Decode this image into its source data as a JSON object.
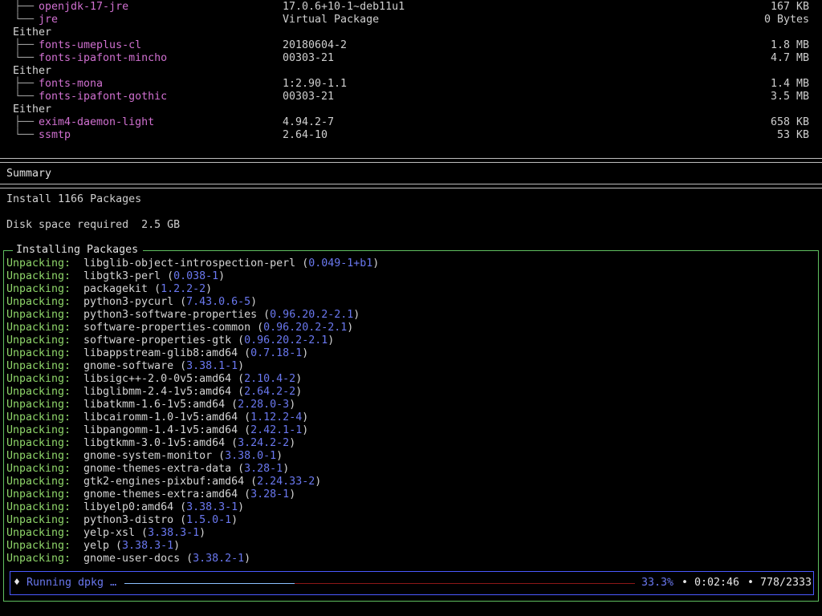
{
  "dependencies": [
    {
      "kind": "pkg",
      "tree": "├──",
      "name": "openjdk-17-jre",
      "version": "17.0.6+10-1~deb11u1",
      "size": "167 KB"
    },
    {
      "kind": "pkg",
      "tree": "└──",
      "name": "jre",
      "version": "Virtual Package",
      "size": "0 Bytes"
    },
    {
      "kind": "either",
      "label": "Either"
    },
    {
      "kind": "pkg",
      "tree": "├──",
      "name": "fonts-umeplus-cl",
      "version": "20180604-2",
      "size": "1.8 MB"
    },
    {
      "kind": "pkg",
      "tree": "└──",
      "name": "fonts-ipafont-mincho",
      "version": "00303-21",
      "size": "4.7 MB"
    },
    {
      "kind": "either",
      "label": "Either"
    },
    {
      "kind": "pkg",
      "tree": "├──",
      "name": "fonts-mona",
      "version": "1:2.90-1.1",
      "size": "1.4 MB"
    },
    {
      "kind": "pkg",
      "tree": "└──",
      "name": "fonts-ipafont-gothic",
      "version": "00303-21",
      "size": "3.5 MB"
    },
    {
      "kind": "either",
      "label": "Either"
    },
    {
      "kind": "pkg",
      "tree": "├──",
      "name": "exim4-daemon-light",
      "version": "4.94.2-7",
      "size": "658 KB"
    },
    {
      "kind": "pkg",
      "tree": "└──",
      "name": "ssmtp",
      "version": "2.64-10",
      "size": "53 KB"
    }
  ],
  "summary": {
    "title": "Summary",
    "install": "Install 1166 Packages",
    "disk": "Disk space required  2.5 GB"
  },
  "installing": {
    "title": "Installing Packages",
    "unpack_label": "Unpacking:",
    "lines": [
      {
        "name": "libglib-object-introspection-perl",
        "version": "0.049-1+b1"
      },
      {
        "name": "libgtk3-perl",
        "version": "0.038-1"
      },
      {
        "name": "packagekit",
        "version": "1.2.2-2"
      },
      {
        "name": "python3-pycurl",
        "version": "7.43.0.6-5"
      },
      {
        "name": "python3-software-properties",
        "version": "0.96.20.2-2.1"
      },
      {
        "name": "software-properties-common",
        "version": "0.96.20.2-2.1"
      },
      {
        "name": "software-properties-gtk",
        "version": "0.96.20.2-2.1"
      },
      {
        "name": "libappstream-glib8:amd64",
        "version": "0.7.18-1"
      },
      {
        "name": "gnome-software",
        "version": "3.38.1-1"
      },
      {
        "name": "libsigc++-2.0-0v5:amd64",
        "version": "2.10.4-2"
      },
      {
        "name": "libglibmm-2.4-1v5:amd64",
        "version": "2.64.2-2"
      },
      {
        "name": "libatkmm-1.6-1v5:amd64",
        "version": "2.28.0-3"
      },
      {
        "name": "libcairomm-1.0-1v5:amd64",
        "version": "1.12.2-4"
      },
      {
        "name": "libpangomm-1.4-1v5:amd64",
        "version": "2.42.1-1"
      },
      {
        "name": "libgtkmm-3.0-1v5:amd64",
        "version": "3.24.2-2"
      },
      {
        "name": "gnome-system-monitor",
        "version": "3.38.0-1"
      },
      {
        "name": "gnome-themes-extra-data",
        "version": "3.28-1"
      },
      {
        "name": "gtk2-engines-pixbuf:amd64",
        "version": "2.24.33-2"
      },
      {
        "name": "gnome-themes-extra:amd64",
        "version": "3.28-1"
      },
      {
        "name": "libyelp0:amd64",
        "version": "3.38.3-1"
      },
      {
        "name": "python3-distro",
        "version": "1.5.0-1"
      },
      {
        "name": "yelp-xsl",
        "version": "3.38.3-1"
      },
      {
        "name": "yelp",
        "version": "3.38.3-1"
      },
      {
        "name": "gnome-user-docs",
        "version": "3.38.2-1"
      }
    ]
  },
  "status": {
    "spinner": "♦",
    "label": "Running dpkg …",
    "progress": 0.333,
    "percent": "33.3%",
    "elapsed": "• 0:02:46",
    "count": "• 778/2333"
  }
}
